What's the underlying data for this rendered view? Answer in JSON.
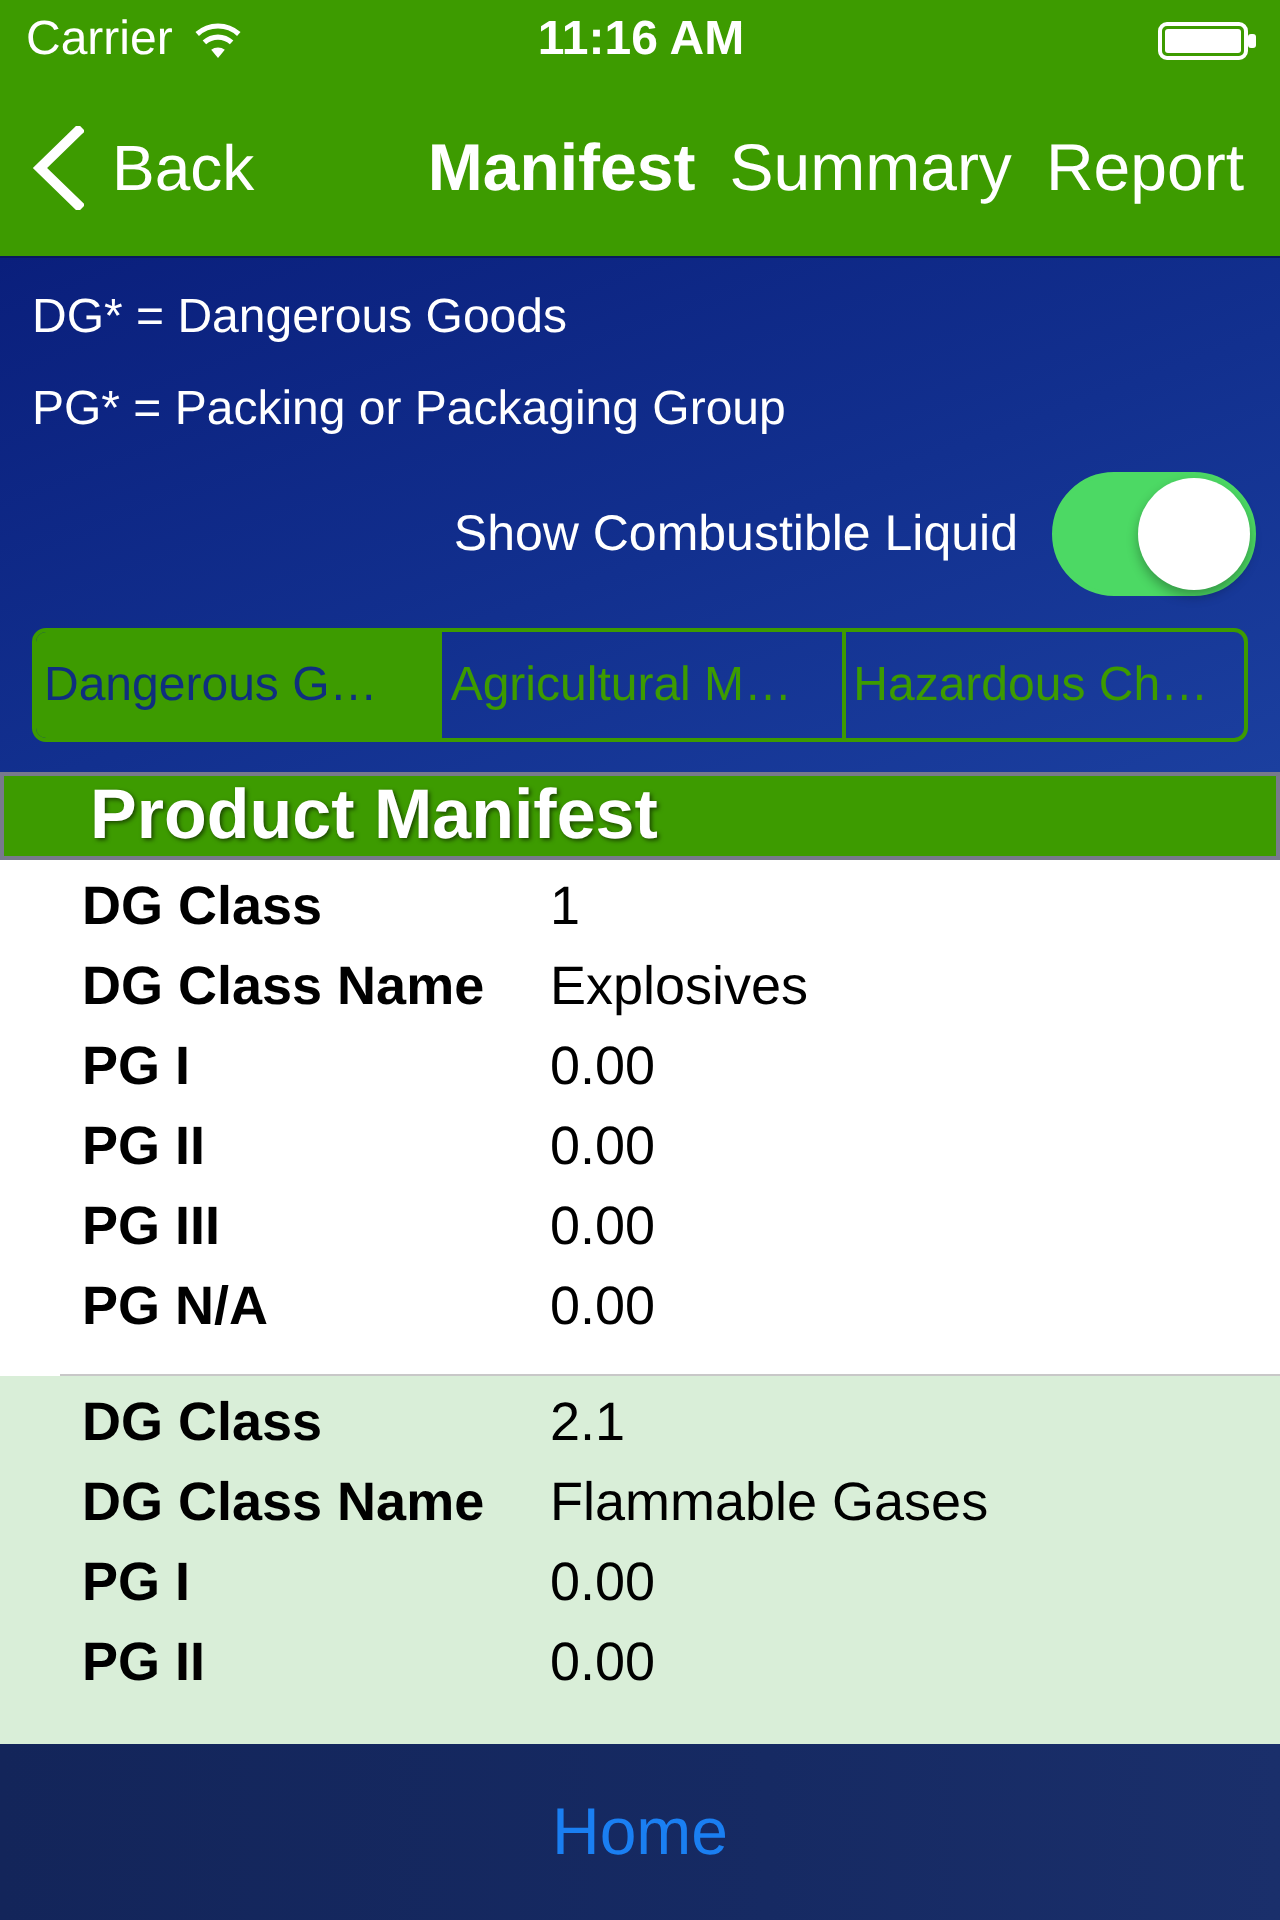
{
  "status_bar": {
    "carrier": "Carrier",
    "time": "11:16 AM"
  },
  "nav_bar": {
    "back": "Back",
    "tabs": [
      {
        "label": "Manifest",
        "selected": true
      },
      {
        "label": "Summary",
        "selected": false
      },
      {
        "label": "Report",
        "selected": false
      }
    ]
  },
  "legend": [
    "DG* = Dangerous Goods",
    "PG* = Packing or Packaging Group"
  ],
  "toggle": {
    "label": "Show Combustible Liquid",
    "on": true
  },
  "segments": [
    {
      "label": "Dangerous G…",
      "selected": true
    },
    {
      "label": "Agricultural M…",
      "selected": false
    },
    {
      "label": "Hazardous Ch…",
      "selected": false
    }
  ],
  "section_title": "Product Manifest",
  "entries": [
    {
      "fields": [
        {
          "label": "DG Class",
          "value": "1"
        },
        {
          "label": "DG Class Name",
          "value": "Explosives"
        },
        {
          "label": "PG I",
          "value": "0.00"
        },
        {
          "label": "PG II",
          "value": "0.00"
        },
        {
          "label": "PG III",
          "value": "0.00"
        },
        {
          "label": "PG N/A",
          "value": "0.00"
        }
      ]
    },
    {
      "fields": [
        {
          "label": "DG Class",
          "value": "2.1"
        },
        {
          "label": "DG Class Name",
          "value": "Flammable Gases"
        },
        {
          "label": "PG I",
          "value": "0.00"
        },
        {
          "label": "PG II",
          "value": "0.00"
        }
      ]
    }
  ],
  "bottom_bar": {
    "button": "Home"
  }
}
